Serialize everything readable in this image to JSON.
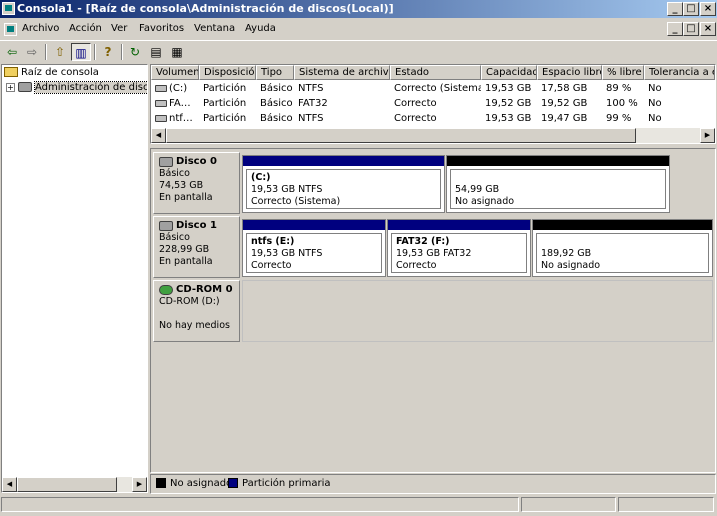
{
  "window": {
    "title": "Consola1 - [Raíz de consola\\Administración de discos(Local)]",
    "controls": [
      "_",
      "□",
      "×"
    ]
  },
  "menu": [
    "Archivo",
    "Acción",
    "Ver",
    "Favoritos",
    "Ventana",
    "Ayuda"
  ],
  "mdi_controls": [
    "_",
    "□",
    "×"
  ],
  "toolbar": {
    "icons": [
      "back-arrow-icon",
      "forward-arrow-icon",
      "up-folder-icon",
      "show-tree-icon",
      "help-icon",
      "refresh-icon",
      "properties-icon",
      "disk-properties-icon"
    ],
    "glyphs": [
      "⇦",
      "⇨",
      "⇧",
      "▥",
      "?",
      "↻",
      "▤",
      "▦"
    ]
  },
  "tree": {
    "root": "Raíz de consola",
    "child": "Administración de discos(",
    "expander": "+"
  },
  "volume_table": {
    "columns": [
      "Volumen",
      "Disposición",
      "Tipo",
      "Sistema de archivos",
      "Estado",
      "Capacidad",
      "Espacio libre",
      "% libre",
      "Tolerancia a err"
    ],
    "rows": [
      [
        "(C:)",
        "Partición",
        "Básico",
        "NTFS",
        "Correcto (Sistema)",
        "19,53 GB",
        "17,58 GB",
        "89 %",
        "No"
      ],
      [
        "FA…",
        "Partición",
        "Básico",
        "FAT32",
        "Correcto",
        "19,52 GB",
        "19,52 GB",
        "100 %",
        "No"
      ],
      [
        "ntf…",
        "Partición",
        "Básico",
        "NTFS",
        "Correcto",
        "19,53 GB",
        "19,47 GB",
        "99 %",
        "No"
      ]
    ]
  },
  "disks": [
    {
      "name": "Disco 0",
      "lines": [
        "Básico",
        "74,53 GB",
        "En pantalla"
      ],
      "partitions": [
        {
          "label": "(C:)",
          "size": "19,53 GB NTFS",
          "status": "Correcto (Sistema)",
          "color": "#00007f"
        },
        {
          "label": "",
          "size": "54,99 GB",
          "status": "No asignado",
          "color": "#000000"
        }
      ]
    },
    {
      "name": "Disco 1",
      "lines": [
        "Básico",
        "228,99 GB",
        "En pantalla"
      ],
      "partitions": [
        {
          "label": "ntfs  (E:)",
          "size": "19,53 GB NTFS",
          "status": "Correcto",
          "color": "#00007f"
        },
        {
          "label": "FAT32  (F:)",
          "size": "19,53 GB FAT32",
          "status": "Correcto",
          "color": "#00007f"
        },
        {
          "label": "",
          "size": "189,92 GB",
          "status": "No asignado",
          "color": "#000000"
        }
      ]
    },
    {
      "name": "CD-ROM 0",
      "lines": [
        "CD-ROM (D:)",
        "",
        "No hay medios"
      ],
      "partitions": []
    }
  ],
  "legend": [
    {
      "label": "No asignado",
      "color": "#000000"
    },
    {
      "label": "Partición primaria",
      "color": "#00007f"
    }
  ],
  "scroll_arrows": {
    "left": "◀",
    "right": "▶"
  }
}
